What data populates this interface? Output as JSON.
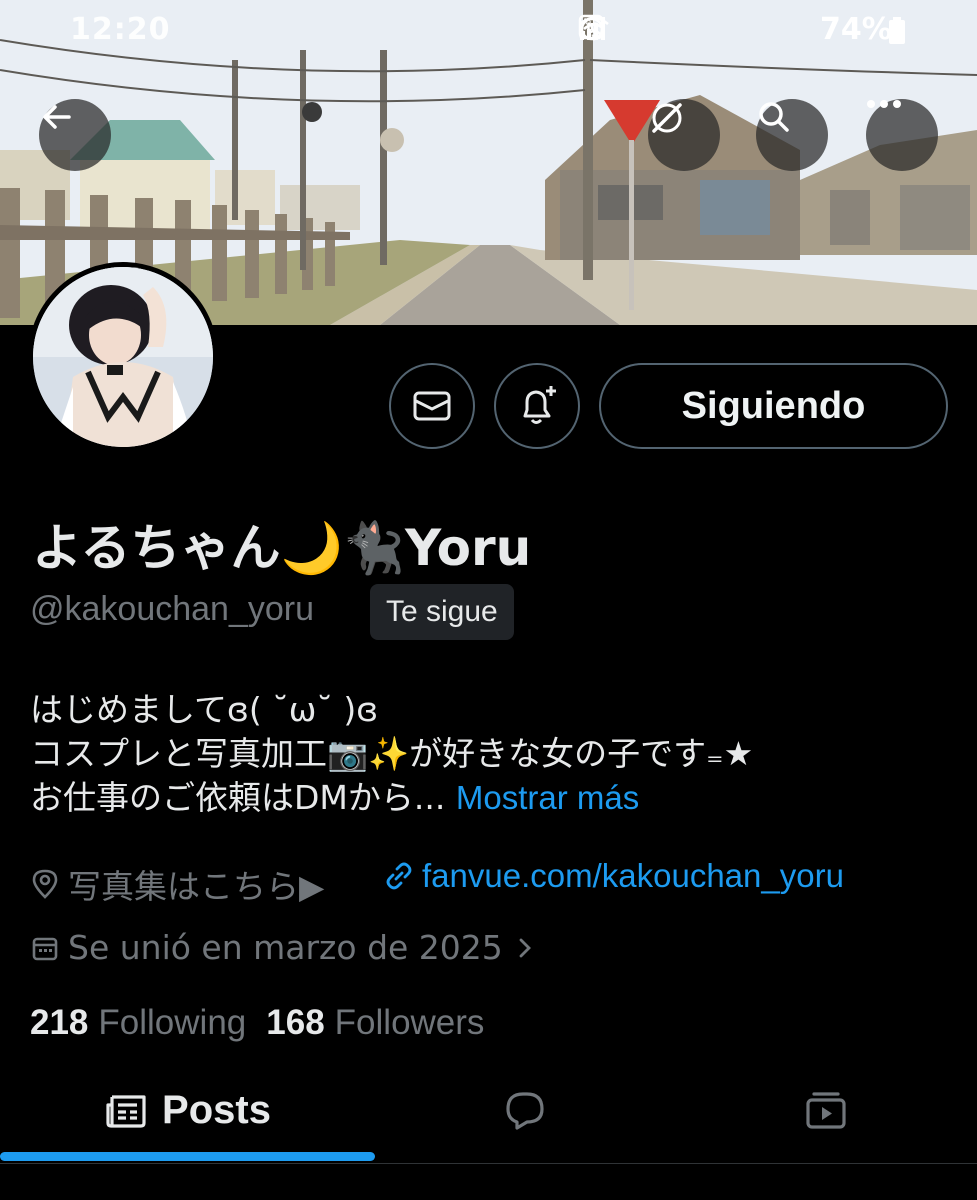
{
  "status_bar": {
    "time": "12:20",
    "battery": "74%",
    "icons": [
      "gallery-icon",
      "gmail-icon",
      "download-icon",
      "nfc-icon",
      "alarm-icon",
      "wifi-icon",
      "volte-icon",
      "signal-icon",
      "battery-icon"
    ]
  },
  "header": {
    "back_icon": "arrow-left-icon",
    "grok_icon": "grok-icon",
    "search_icon": "search-icon",
    "more_icon": "more-icon"
  },
  "actions": {
    "message_icon": "mail-icon",
    "notify_icon": "bell-plus-icon",
    "follow_label": "Siguiendo"
  },
  "profile": {
    "display_name": "よるちゃん🌙🐈‍⬛Yoru",
    "handle": "@kakouchan_yoru",
    "follows_you": "Te sigue",
    "bio_line1": "はじめましてɞ( ˘ω˘ )ɞ",
    "bio_line2": "コスプレと写真加工📷✨が好きな女の子です₌★",
    "bio_line3": "お仕事のご依頼はDMから...",
    "bio_more": "Mostrar más",
    "location": "写真集はこちら▶",
    "website": "fanvue.com/kakouchan_yoru",
    "joined": "Se unió en marzo de 2025",
    "following_count": "218",
    "following_label": "Following",
    "followers_count": "168",
    "followers_label": "Followers"
  },
  "tabs": {
    "posts_label": "Posts",
    "posts_icon": "posts-icon",
    "replies_icon": "reply-icon",
    "media_icon": "media-icon"
  },
  "colors": {
    "accent": "#1d9bf0",
    "background": "#000000",
    "muted": "#71767b",
    "border": "#536471"
  }
}
